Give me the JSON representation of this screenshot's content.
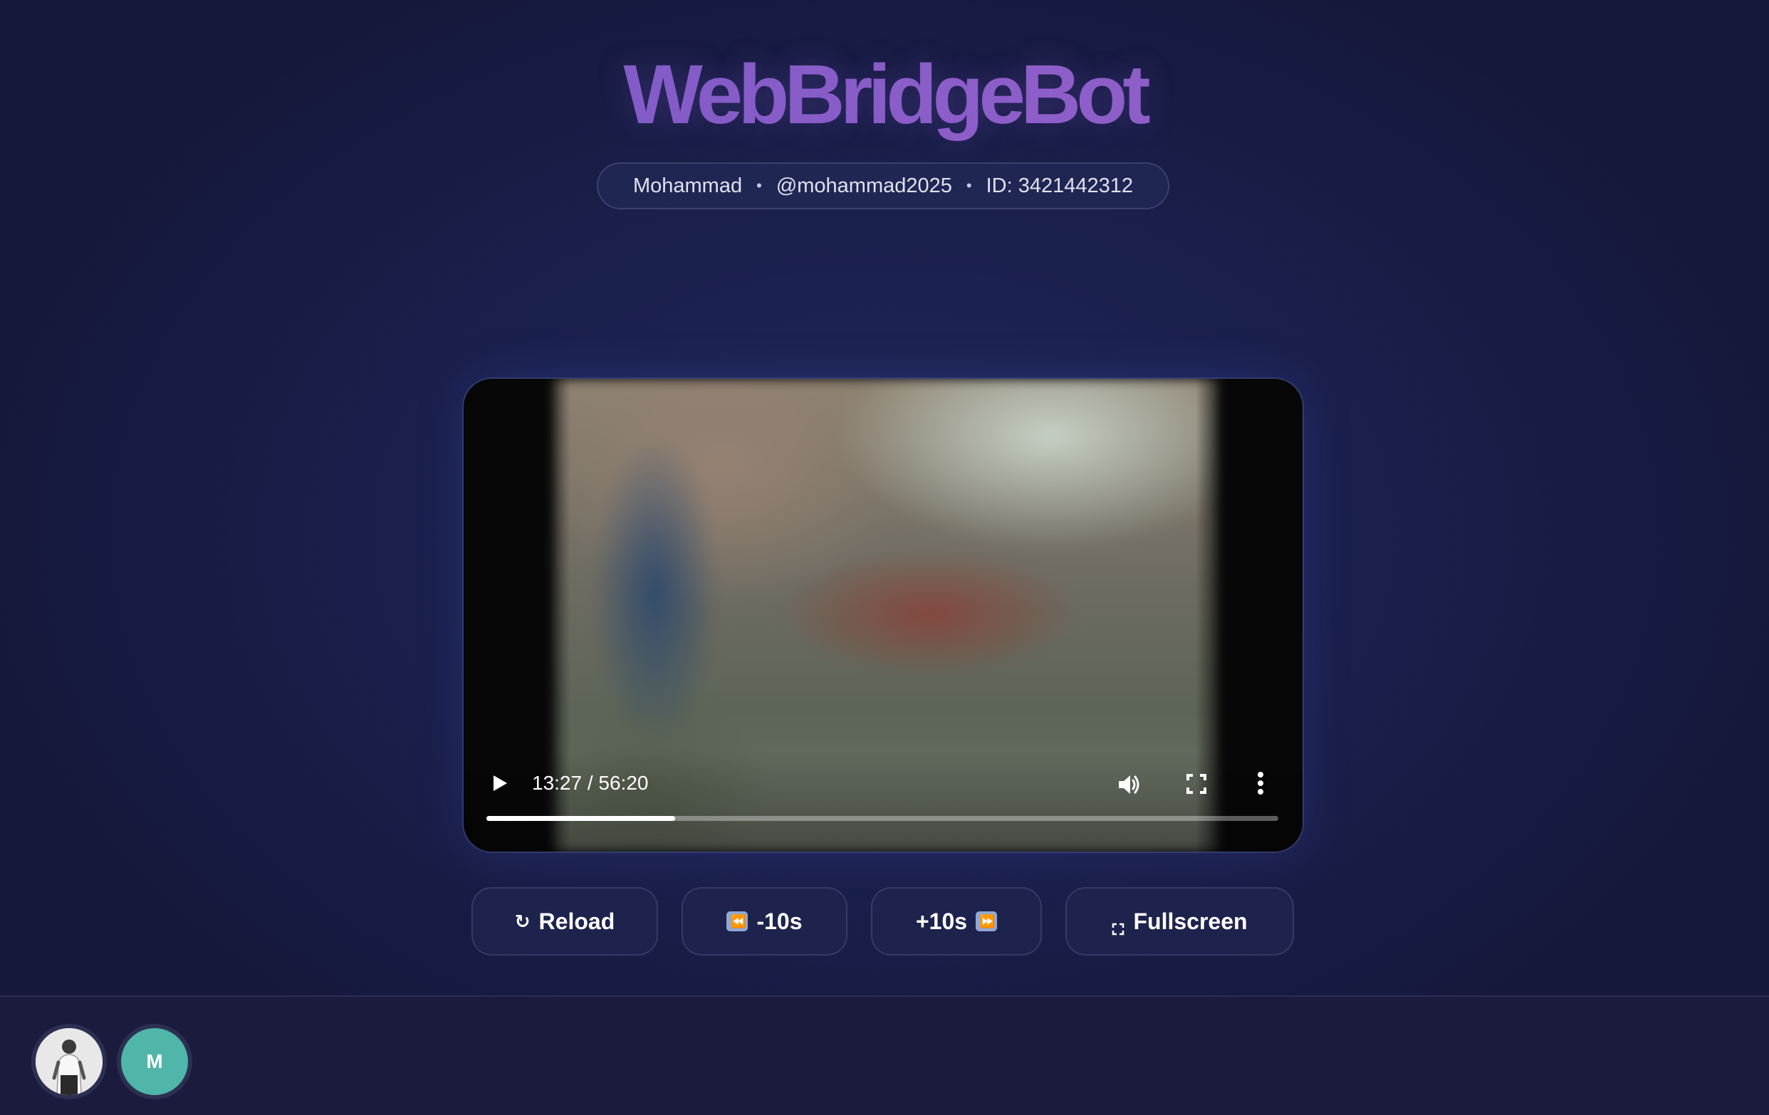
{
  "app": {
    "title": "WebBridgeBot"
  },
  "user": {
    "name": "Mohammad",
    "separator": "•",
    "username": "@mohammad2025",
    "id_label": "ID: 3421442312"
  },
  "player": {
    "current_time": "13:27",
    "duration": "56:20",
    "time_display": "13:27 / 56:20",
    "progress_fraction": 0.238,
    "icons": {
      "play": "play-icon",
      "volume": "volume-icon",
      "fullscreen": "fullscreen-icon",
      "more": "more-vertical-icon"
    }
  },
  "actions": {
    "reload": {
      "icon": "↻",
      "label": "Reload"
    },
    "back": {
      "icon": "⏪",
      "label": "-10s"
    },
    "forward": {
      "icon": "⏩",
      "label": "+10s"
    },
    "fullscreen": {
      "icon": "⛶",
      "label": "Fullscreen"
    }
  },
  "footer": {
    "avatars": [
      {
        "type": "photo",
        "icon": "user-photo"
      },
      {
        "type": "initial",
        "letter": "M",
        "color": "#4fb6a9"
      }
    ]
  },
  "colors": {
    "background": "#1b2150",
    "brand_gradient_start": "#6f56c4",
    "brand_gradient_end": "#9a62c4",
    "button_bg": "#1e244e",
    "avatar_teal": "#4fb6a9"
  }
}
